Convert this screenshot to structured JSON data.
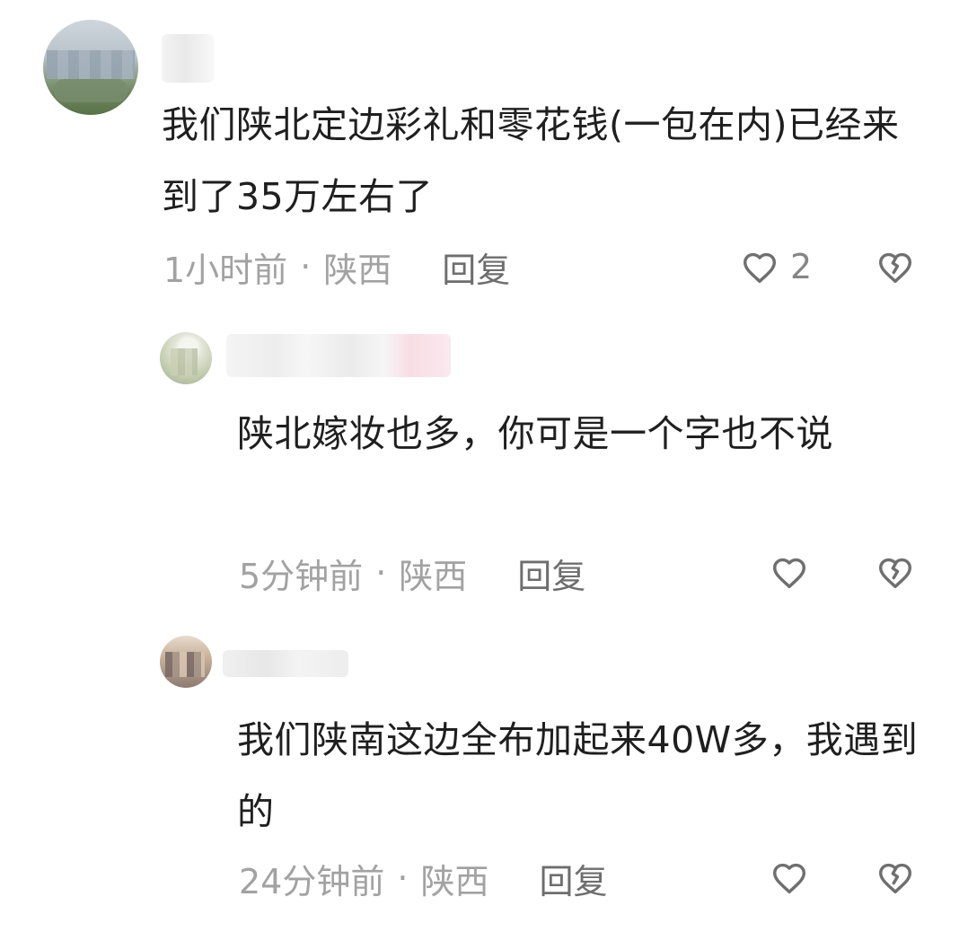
{
  "comments": {
    "top": {
      "text": "我们陕北定边彩礼和零花钱(一包在内)已经来到了35万左右了",
      "time": "1小时前",
      "dot": "·",
      "location": "陕西",
      "reply_label": "回复",
      "like_count": "2",
      "icons": {
        "like": "heart-icon",
        "dislike": "broken-heart-icon"
      }
    },
    "reply_1": {
      "text": "陕北嫁妆也多，你可是一个字也不说",
      "time": "5分钟前",
      "dot": "·",
      "location": "陕西",
      "reply_label": "回复",
      "icons": {
        "like": "heart-icon",
        "dislike": "broken-heart-icon"
      }
    },
    "reply_2": {
      "text": "我们陕南这边全布加起来40W多，我遇到的",
      "time": "24分钟前",
      "dot": "·",
      "location": "陕西",
      "reply_label": "回复",
      "icons": {
        "like": "heart-icon",
        "dislike": "broken-heart-icon"
      }
    }
  }
}
